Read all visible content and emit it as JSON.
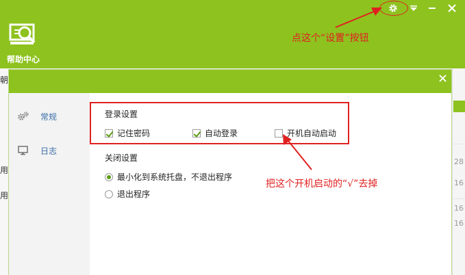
{
  "main_window": {
    "title": "帮助中心",
    "side_texts": [
      "朝",
      "用",
      "用"
    ],
    "right_numbers": [
      "28",
      "16",
      "16",
      "16"
    ],
    "controls": {
      "settings_icon": "gear-icon",
      "menu_icon": "triangle-down-icon",
      "minimize_icon": "minus-icon",
      "close_icon": "close-icon"
    }
  },
  "dialog": {
    "nav": [
      {
        "label": "常规",
        "icon": "gears-icon"
      },
      {
        "label": "日志",
        "icon": "monitor-icon"
      }
    ],
    "login_settings": {
      "title": "登录设置",
      "options": [
        {
          "label": "记住密码",
          "checked": true
        },
        {
          "label": "自动登录",
          "checked": true
        },
        {
          "label": "开机自动启动",
          "checked": false
        }
      ]
    },
    "close_settings": {
      "title": "关闭设置",
      "options": [
        {
          "label": "最小化到系统托盘，不退出程序",
          "selected": true
        },
        {
          "label": "退出程序",
          "selected": false
        }
      ]
    }
  },
  "annotations": {
    "settings_hint": "点这个“设置”按钮",
    "autostart_hint": "把这个开机启动的“√”去掉"
  },
  "colors": {
    "accent_green": "#8ec21f",
    "annotation_red": "#e02020",
    "nav_text": "#3a6fa8"
  }
}
